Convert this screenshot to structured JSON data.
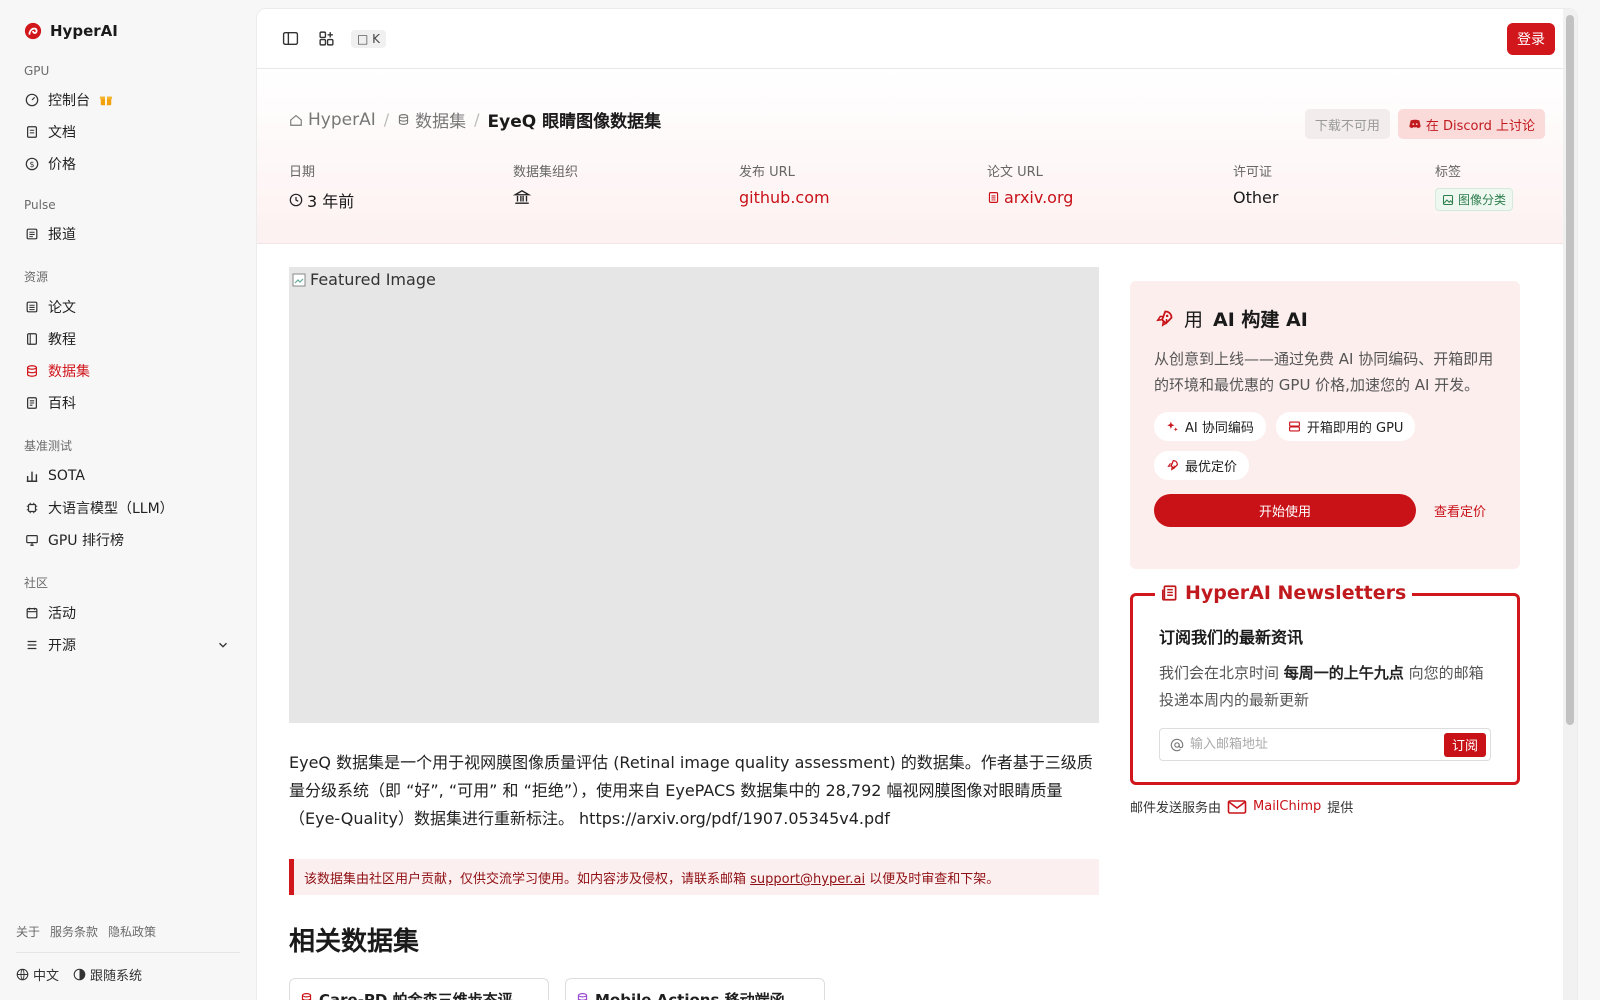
{
  "brand": {
    "name": "HyperAI"
  },
  "sidebar": {
    "sections": [
      {
        "label": "GPU",
        "items": [
          {
            "label": "控制台"
          },
          {
            "label": "文档"
          },
          {
            "label": "价格"
          }
        ]
      },
      {
        "label": "Pulse",
        "items": [
          {
            "label": "报道"
          }
        ]
      },
      {
        "label": "资源",
        "items": [
          {
            "label": "论文"
          },
          {
            "label": "教程"
          },
          {
            "label": "数据集"
          },
          {
            "label": "百科"
          }
        ]
      },
      {
        "label": "基准测试",
        "items": [
          {
            "label": "SOTA"
          },
          {
            "label": "大语言模型（LLM）"
          },
          {
            "label": "GPU 排行榜"
          }
        ]
      },
      {
        "label": "社区",
        "items": [
          {
            "label": "活动"
          },
          {
            "label": "开源"
          }
        ]
      }
    ],
    "active": "数据集",
    "footer_links": [
      "关于",
      "服务条款",
      "隐私政策"
    ],
    "language": "中文",
    "theme": "跟随系统"
  },
  "topbar": {
    "shortcut": "K",
    "login": "登录"
  },
  "breadcrumb": {
    "home": "HyperAI",
    "section": "数据集",
    "current": "EyeQ 眼睛图像数据集"
  },
  "actions": {
    "download": "下载不可用",
    "discord": "在 Discord 上讨论"
  },
  "meta": {
    "date_label": "日期",
    "date_value": "3 年前",
    "org_label": "数据集组织",
    "release_label": "发布 URL",
    "release_value": "github.com",
    "paper_label": "论文 URL",
    "paper_value": "arxiv.org",
    "license_label": "许可证",
    "license_value": "Other",
    "tags_label": "标签",
    "tag_value": "图像分类"
  },
  "featured": {
    "alt": "Featured Image"
  },
  "description": "EyeQ 数据集是一个用于视网膜图像质量评估 (Retinal image quality assessment) 的数据集。作者基于三级质量分级系统（即 “好”, “可用” 和 “拒绝”），使用来自 EyePACS 数据集中的 28,792 幅视网膜图像对眼睛质量（Eye-Quality）数据集进行重新标注。 https://arxiv.org/pdf/1907.05345v4.pdf",
  "notice": {
    "before": "该数据集由社区用户贡献，仅供交流学习使用。如内容涉及侵权，请联系邮箱 ",
    "email": "support@hyper.ai",
    "after": " 以便及时审查和下架。"
  },
  "related": {
    "title": "相关数据集",
    "cards": [
      {
        "title": "Care-PD 帕金森三维步态评..."
      },
      {
        "title": "Mobile Actions 移动端函..."
      }
    ]
  },
  "promo": {
    "title_prefix": "用",
    "title_bold": "AI 构建 AI",
    "desc": "从创意到上线——通过免费 AI 协同编码、开箱即用的环境和最优惠的 GPU 价格,加速您的 AI 开发。",
    "chips": [
      "AI 协同编码",
      "开箱即用的 GPU",
      "最优定价"
    ],
    "start": "开始使用",
    "pricing": "查看定价"
  },
  "newsletter": {
    "title": "HyperAI Newsletters",
    "subtitle": "订阅我们的最新资讯",
    "desc_before": "我们会在北京时间 ",
    "desc_bold": "每周一的上午九点",
    "desc_after": " 向您的邮箱投递本周内的最新更新",
    "placeholder": "输入邮箱地址",
    "subscribe": "订阅",
    "credit_before": "邮件发送服务由",
    "credit_brand": "MailChimp",
    "credit_after": "提供"
  },
  "colors": {
    "accent": "#d1161c",
    "sidebar_bg": "#f7f7f8"
  }
}
